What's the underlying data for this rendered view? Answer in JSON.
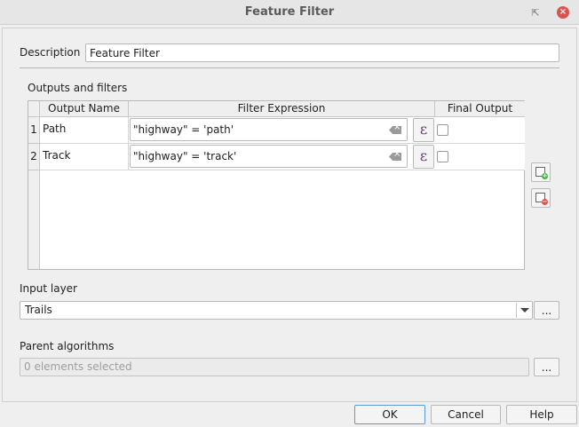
{
  "window": {
    "title": "Feature Filter",
    "restore_glyph": "⇱",
    "close_glyph": "×"
  },
  "description": {
    "label": "Description",
    "value": "Feature Filter"
  },
  "outputs": {
    "section_label": "Outputs and filters",
    "columns": [
      "Output Name",
      "Filter Expression",
      "Final Output"
    ],
    "rows": [
      {
        "index": "1",
        "name": "Path",
        "expression": "\"highway\" = 'path'",
        "final": false
      },
      {
        "index": "2",
        "name": "Track",
        "expression": "\"highway\" = 'track'",
        "final": false
      }
    ],
    "expression_button_glyph": "ε",
    "add_icon": "add-row-icon",
    "remove_icon": "remove-row-icon"
  },
  "input_layer": {
    "label": "Input layer",
    "selected": "Trails",
    "browse_label": "..."
  },
  "parent_algorithms": {
    "label": "Parent algorithms",
    "placeholder": "0 elements selected",
    "browse_label": "..."
  },
  "buttons": {
    "ok": "OK",
    "cancel": "Cancel",
    "help": "Help"
  },
  "colors": {
    "accent_border": "#5b9bd5",
    "close_button": "#d9534f",
    "epsilon": "#6a3d7b"
  }
}
